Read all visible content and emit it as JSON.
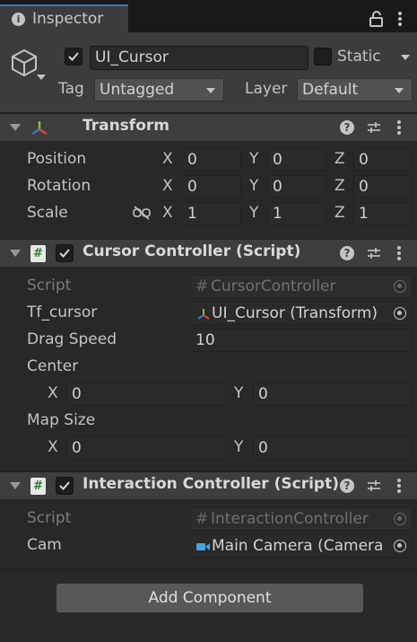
{
  "tab": {
    "label": "Inspector"
  },
  "object": {
    "active": true,
    "name": "UI_Cursor",
    "static_label": "Static",
    "tag_label": "Tag",
    "tag_value": "Untagged",
    "layer_label": "Layer",
    "layer_value": "Default"
  },
  "transform": {
    "title": "Transform",
    "position": {
      "label": "Position",
      "x": "0",
      "y": "0",
      "z": "0"
    },
    "rotation": {
      "label": "Rotation",
      "x": "0",
      "y": "0",
      "z": "0"
    },
    "scale": {
      "label": "Scale",
      "x": "1",
      "y": "1",
      "z": "1"
    },
    "axis": {
      "x": "X",
      "y": "Y",
      "z": "Z"
    }
  },
  "cursor_controller": {
    "title": "Cursor Controller (Script)",
    "script_label": "Script",
    "script_value": "CursorController",
    "tf_cursor_label": "Tf_cursor",
    "tf_cursor_value": "UI_Cursor (Transform)",
    "drag_speed_label": "Drag Speed",
    "drag_speed_value": "10",
    "center_label": "Center",
    "center_x": "0",
    "center_y": "0",
    "map_size_label": "Map Size",
    "map_size_x": "0",
    "map_size_y": "0",
    "axis_x": "X",
    "axis_y": "Y"
  },
  "interaction_controller": {
    "title": "Interaction Controller (Script)",
    "script_label": "Script",
    "script_value": "InteractionController",
    "cam_label": "Cam",
    "cam_value": "Main Camera (Camera"
  },
  "add_component_label": "Add Component",
  "colors": {
    "accent": "#3a79bb",
    "panel": "#282828",
    "header": "#3e3e3e"
  }
}
